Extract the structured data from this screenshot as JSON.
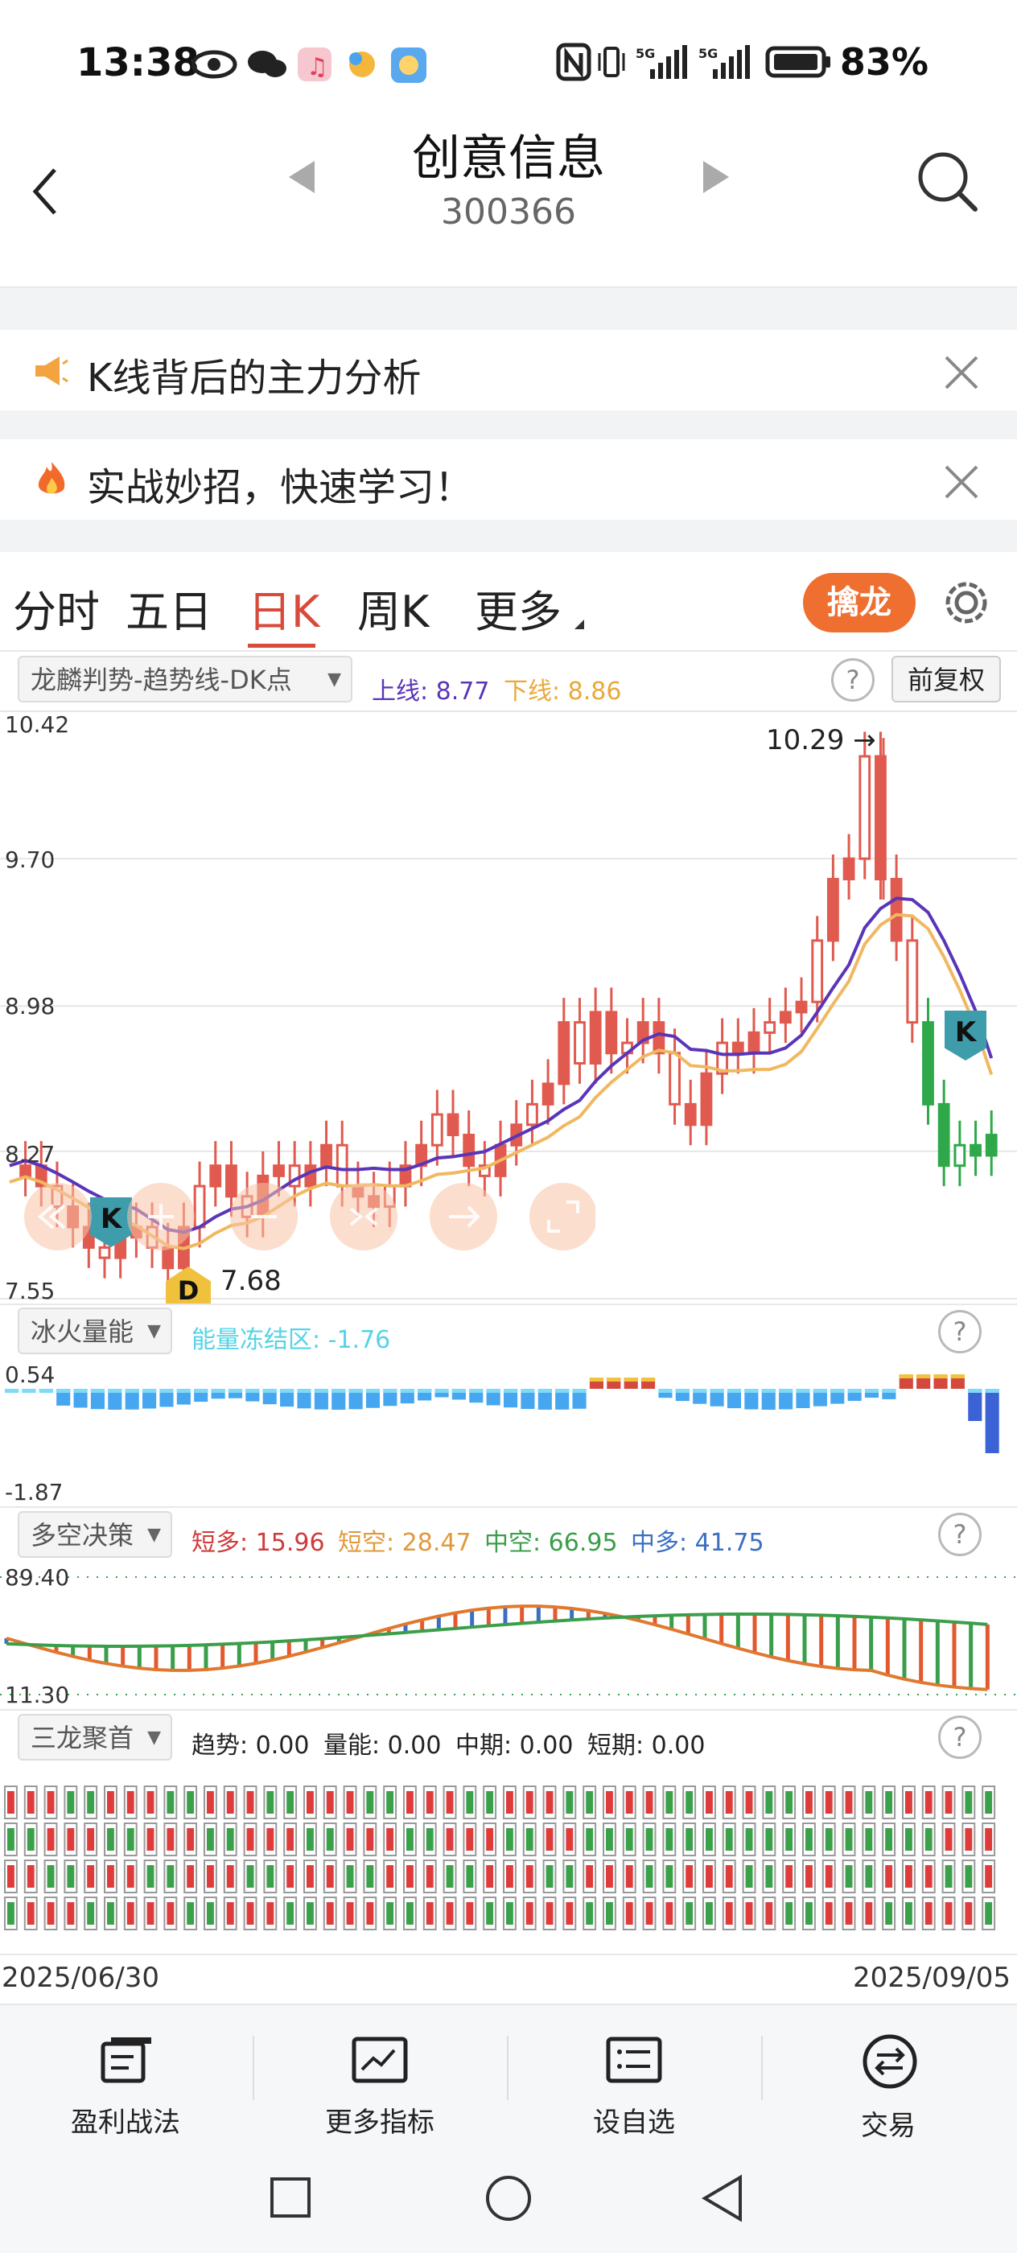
{
  "status_bar": {
    "time": "13:38",
    "battery": "83%"
  },
  "header": {
    "title": "创意信息",
    "code": "300366"
  },
  "banners": [
    {
      "text": "K线背后的主力分析"
    },
    {
      "text": "实战妙招，快速学习！"
    }
  ],
  "tabs": [
    "分时",
    "五日",
    "日K",
    "周K",
    "更多"
  ],
  "active_tab": "日K",
  "qinlong_label": "擒龙",
  "main_chart": {
    "indicator": "龙麟判势-趋势线-DK点",
    "upper_label": "上线: 8.77",
    "lower_label": "下线: 8.86",
    "adjust_label": "前复权",
    "y_ticks": [
      "10.42",
      "9.70",
      "8.98",
      "8.27",
      "7.55"
    ],
    "high_label": "10.29",
    "low_label": "7.68",
    "k_marker": "K",
    "d_marker": "D",
    "colors": {
      "up": "#e05a4f",
      "down": "#2fa84a",
      "line_upper": "#5a35b8",
      "line_lower": "#f0b860"
    }
  },
  "energy_panel": {
    "name": "冰火量能",
    "label": "能量冻结区: -1.76",
    "y_top": "0.54",
    "y_bottom": "-1.87"
  },
  "bullbear_panel": {
    "name": "多空决策",
    "labels": [
      "短多: 15.96",
      "短空: 28.47",
      "中空: 66.95",
      "中多: 41.75"
    ],
    "y_top": "89.40",
    "y_bottom": "11.30"
  },
  "sanlong_panel": {
    "name": "三龙聚首",
    "labels": [
      "趋势: 0.00",
      "量能: 0.00",
      "中期: 0.00",
      "短期: 0.00"
    ]
  },
  "date_range": {
    "start": "2025/06/30",
    "end": "2025/09/05"
  },
  "bottom_nav": [
    "盈利战法",
    "更多指标",
    "设自选",
    "交易"
  ]
}
